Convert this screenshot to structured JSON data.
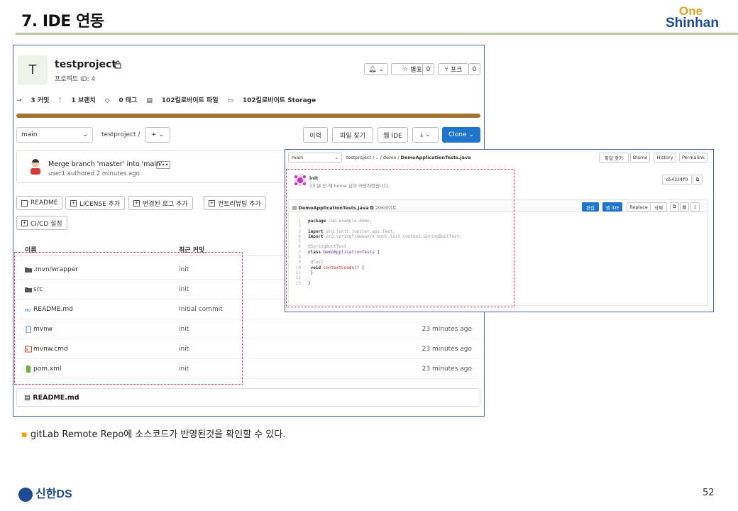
{
  "slide": {
    "title": "7. IDE 연동",
    "logo_top": "One",
    "logo_bottom": "Shinhan",
    "bullet_text": "gitLab Remote Repo에 소스코드가 반영된것을 확인할 수 있다.",
    "footer_logo": "신한DS",
    "page_number": "52"
  },
  "project": {
    "avatar_letter": "T",
    "name": "testproject",
    "id_label": "프로젝트 ID: 4",
    "notify_label": "",
    "star_label": "별표",
    "star_count": "0",
    "fork_label": "포크",
    "fork_count": "0",
    "stats": {
      "commits": "3 커밋",
      "branches": "1 브랜치",
      "tags": "0 태그",
      "files": "102킬로바이트 파일",
      "storage": "102킬로바이트 Storage"
    }
  },
  "toolbar": {
    "branch": "main",
    "path": "testproject",
    "add_label": "+",
    "history": "이력",
    "find_file": "파일 찾기",
    "web_ide": "웹 IDE",
    "download": "",
    "clone": "Clone"
  },
  "last_commit": {
    "message": "Merge branch 'master' into 'main'",
    "author_line": "user1 authored 2 minutes ago",
    "more": "•••"
  },
  "quick_buttons": [
    "README",
    "LICENSE 추가",
    "변경된 로그 추가",
    "컨트리뷰팅 추가",
    "CI/CD 설정"
  ],
  "table": {
    "headers": {
      "name": "이름",
      "last_commit": "최근 커밋"
    },
    "rows": [
      {
        "icon": "folder-icon",
        "name": ".mvn/wrapper",
        "commit": "init",
        "time": ""
      },
      {
        "icon": "folder-icon",
        "name": "src",
        "commit": "init",
        "time": ""
      },
      {
        "icon": "markdown-icon",
        "name": "README.md",
        "commit": "Initial commit",
        "time": ""
      },
      {
        "icon": "file-icon",
        "name": "mvnw",
        "commit": "init",
        "time": "23 minutes ago"
      },
      {
        "icon": "terminal-file-icon",
        "name": "mvnw.cmd",
        "commit": "init",
        "time": "23 minutes ago"
      },
      {
        "icon": "xml-file-icon",
        "name": "pom.xml",
        "commit": "init",
        "time": "23 minutes ago"
      }
    ]
  },
  "readme_bar": "README.md",
  "overlay": {
    "branch": "main",
    "breadcrumb": "testproject / .. / demo /",
    "file_crumb": "DemoApplicationTests.java",
    "buttons": [
      "파일 찾기",
      "Blame",
      "History",
      "Permalink"
    ],
    "commit_title": "init",
    "commit_sub": "23 분 전 에 home 님이 커밋하였습니다.",
    "commit_sha": "d54324f9",
    "file_name": "DemoApplicationTests.java",
    "file_size": "206바이트",
    "edit": "편집",
    "web_ide": "웹 IDE",
    "replace": "Replace",
    "delete": "삭제",
    "code_lines": [
      "package com.example.demo;",
      "",
      "import org.junit.jupiter.api.Test;",
      "import org.springframework.boot.test.context.SpringBootTest;",
      "",
      "@SpringBootTest",
      "class DemoApplicationTests {",
      "",
      "        @Test",
      "        void contextLoads() {",
      "        }",
      "",
      "}"
    ]
  },
  "colors": {
    "accent_blue": "#1f75cb",
    "highlight_red": "#c0262d",
    "progress": "#a2722f"
  }
}
